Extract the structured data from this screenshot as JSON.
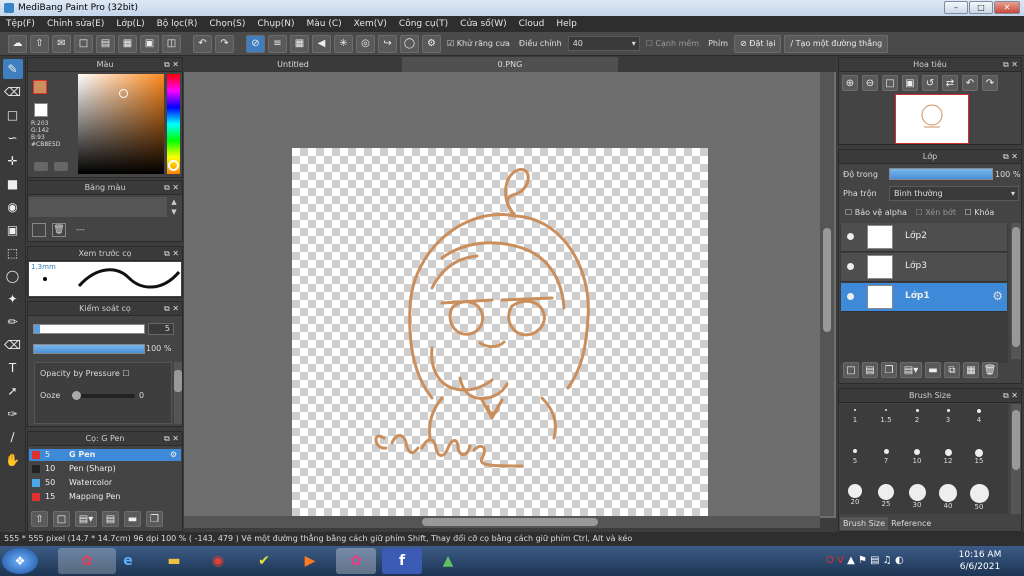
{
  "window": {
    "title": "MediBang Paint Pro (32bit)"
  },
  "menu": [
    "Tệp(F)",
    "Chỉnh sửa(E)",
    "Lớp(L)",
    "Bộ lọc(R)",
    "Chọn(S)",
    "Chụp(N)",
    "Màu (C)",
    "Xem(V)",
    "Công cụ(T)",
    "Cửa số(W)",
    "Cloud",
    "Help"
  ],
  "toolbar": {
    "antialias_label": "Khử răng cưa",
    "adjust_label": "Điều chỉnh",
    "adjust_value": "40",
    "edge_label": "Cạnh mềm",
    "pen_label": "Phím",
    "reset_label": "Đặt lại",
    "straight_label": "Tạo một đường thẳng"
  },
  "tabs": [
    "Untitled",
    "0.PNG"
  ],
  "color_panel": {
    "title": "Màu",
    "r": "R:203",
    "g": "G:142",
    "b": "B:93",
    "hex": "#CB8E5D",
    "main_color": "#CB8E5D"
  },
  "palette_panel": {
    "title": "Bảng màu",
    "placeholder": "---"
  },
  "brush_preview": {
    "title": "Xem trước cọ",
    "size": "1.3mm"
  },
  "brush_control": {
    "title": "Kiểm soát cọ",
    "size_value": "5",
    "opacity_value": "100 %",
    "opacity_pressure": "Opacity by Pressure",
    "ooze_label": "Ooze",
    "ooze_value": "0"
  },
  "brush_list": {
    "title": "Cọ: G Pen",
    "items": [
      {
        "size": "5",
        "name": "G Pen",
        "color": "#e03030"
      },
      {
        "size": "10",
        "name": "Pen (Sharp)",
        "color": "#222222"
      },
      {
        "size": "50",
        "name": "Watercolor",
        "color": "#4aa8e8"
      },
      {
        "size": "15",
        "name": "Mapping Pen",
        "color": "#e03030"
      }
    ]
  },
  "navigator": {
    "title": "Hoa tiêu"
  },
  "layers": {
    "title": "Lớp",
    "opacity_label": "Độ trong",
    "opacity_value": "100 %",
    "blend_label": "Pha trộn",
    "blend_value": "Bình thường",
    "protect_alpha": "Bảo vệ alpha",
    "clipping": "Xén bớt",
    "lock": "Khóa",
    "items": [
      "Lớp2",
      "Lớp3",
      "Lớp1"
    ]
  },
  "brush_size": {
    "title": "Brush Size",
    "sizes": [
      "1",
      "1.5",
      "2",
      "3",
      "4",
      "5",
      "7",
      "10",
      "12",
      "15",
      "20",
      "25",
      "30",
      "40",
      "50"
    ],
    "tabs": [
      "Brush Size",
      "Reference"
    ]
  },
  "artwork": {
    "signature": "@nhim"
  },
  "status": "555 * 555 pixel   (14.7 * 14.7cm)   96 dpi   100 %   ( -143, 479 )   Vẽ một đường thẳng bằng cách giữ phím Shift, Thay đổi cỡ cọ bằng cách giữ phím Ctrl, Alt và kéo",
  "taskbar": {
    "time": "10:16 AM",
    "date": "6/6/2021"
  }
}
